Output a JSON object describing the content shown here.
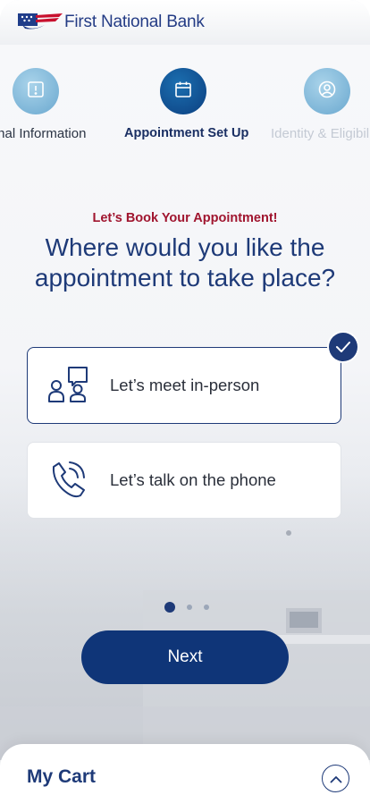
{
  "header": {
    "bank_name": "First National Bank",
    "logo_icon": "flag-eagle-logo"
  },
  "stepper": {
    "steps": [
      {
        "label": "Personal Information",
        "icon": "alert-document-icon",
        "state": "inactive"
      },
      {
        "label": "Appointment Set Up",
        "icon": "calendar-icon",
        "state": "active"
      },
      {
        "label": "Identity & Eligibility",
        "icon": "user-circle-icon",
        "state": "inactive"
      }
    ]
  },
  "main": {
    "kicker": "Let’s Book Your Appointment!",
    "question": "Where would you like the appointment to take place?",
    "options": [
      {
        "label": "Let’s meet in-person",
        "icon": "meeting-people-icon",
        "selected": true
      },
      {
        "label": "Let’s talk on the phone",
        "icon": "phone-ringing-icon",
        "selected": false
      }
    ],
    "pager": {
      "total": 3,
      "current": 1
    },
    "next_label": "Next"
  },
  "cart": {
    "title": "My Cart",
    "toggle_icon": "chevron-up-icon"
  },
  "colors": {
    "primary": "#1e3a78",
    "button": "#0f3578",
    "accent_red": "#a0152f",
    "step_inactive": "#7fb3d4"
  }
}
